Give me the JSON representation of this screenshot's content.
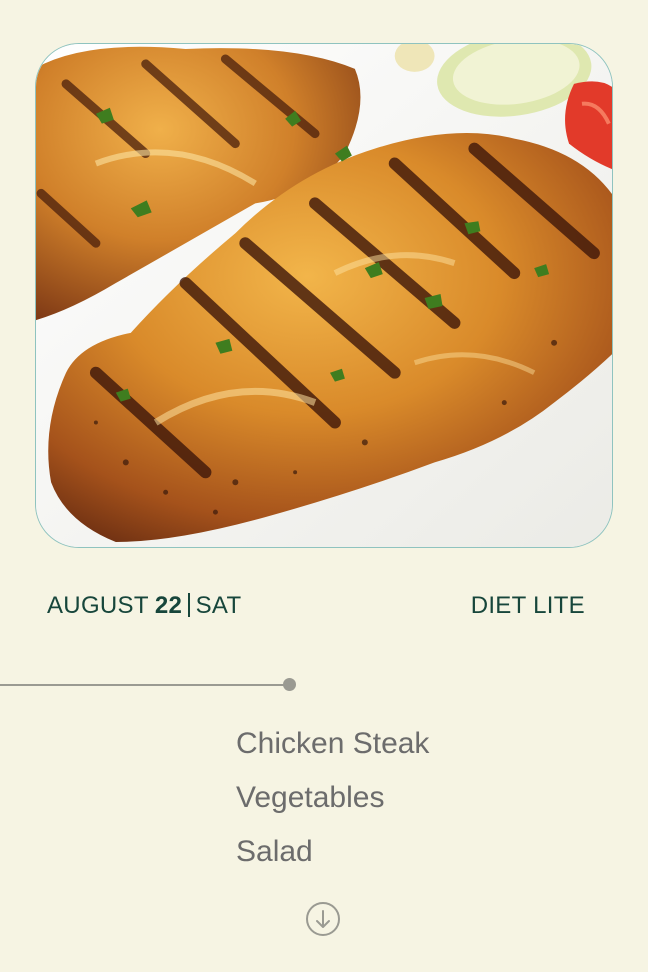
{
  "hero": {
    "image_alt": "grilled-chicken-breasts-photo",
    "colors": {
      "frame_border": "#8fc3bf",
      "plate": "#f7f7f4",
      "chicken_glaze": "#d9892a",
      "char": "#4a1f0c",
      "herbs": "#3f7d1f"
    }
  },
  "meta": {
    "month": "AUGUST",
    "day": "22",
    "weekday": "SAT",
    "plan": "DIET LITE"
  },
  "menu": {
    "items": [
      {
        "label": "Chicken Steak"
      },
      {
        "label": "Vegetables"
      },
      {
        "label": "Salad"
      }
    ]
  },
  "icons": {
    "scroll_down": "arrow-down-circle-icon"
  },
  "theme": {
    "background": "#f6f4e3",
    "accent_text": "#17463b",
    "muted_text": "#6c6c6c",
    "timeline": "#9a9a92"
  }
}
